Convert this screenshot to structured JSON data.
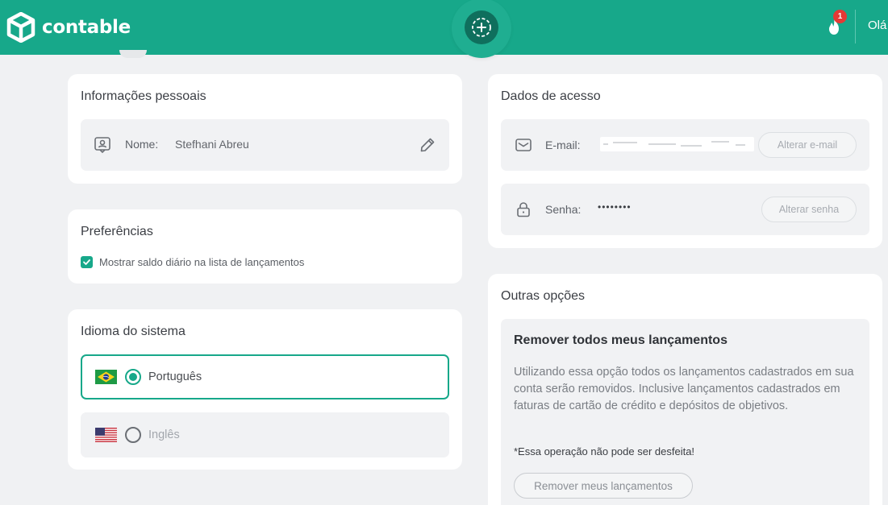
{
  "header": {
    "brand": "contable",
    "notification_count": "1",
    "greeting": "Olá"
  },
  "personal_info": {
    "title": "Informações pessoais",
    "name_label": "Nome:",
    "name_value": "Stefhani Abreu"
  },
  "preferences": {
    "title": "Preferências",
    "show_daily_balance_label": "Mostrar saldo diário na lista de lançamentos",
    "show_daily_balance_checked": true
  },
  "language": {
    "title": "Idioma do sistema",
    "options": [
      {
        "label": "Português",
        "selected": true,
        "flag": "brazil-flag"
      },
      {
        "label": "Inglês",
        "selected": false,
        "flag": "usa-flag"
      }
    ]
  },
  "access": {
    "title": "Dados de acesso",
    "email_label": "E-mail:",
    "email_change_button": "Alterar e-mail",
    "password_label": "Senha:",
    "password_value": "••••••••",
    "password_change_button": "Alterar senha"
  },
  "other_options": {
    "title": "Outras opções",
    "remove_title": "Remover todos meus lançamentos",
    "remove_description": "Utilizando essa opção todos os lançamentos cadastrados em sua conta serão removidos. Inclusive lançamentos cadastrados em faturas de cartão de crédito e depósitos de objetivos.",
    "warning": "*Essa operação não pode ser desfeita!",
    "remove_button": "Remover meus lançamentos"
  },
  "colors": {
    "brand": "#17a88a",
    "fab": "#0f6f5d",
    "badge": "#e53935",
    "background": "#f0f1f3"
  }
}
